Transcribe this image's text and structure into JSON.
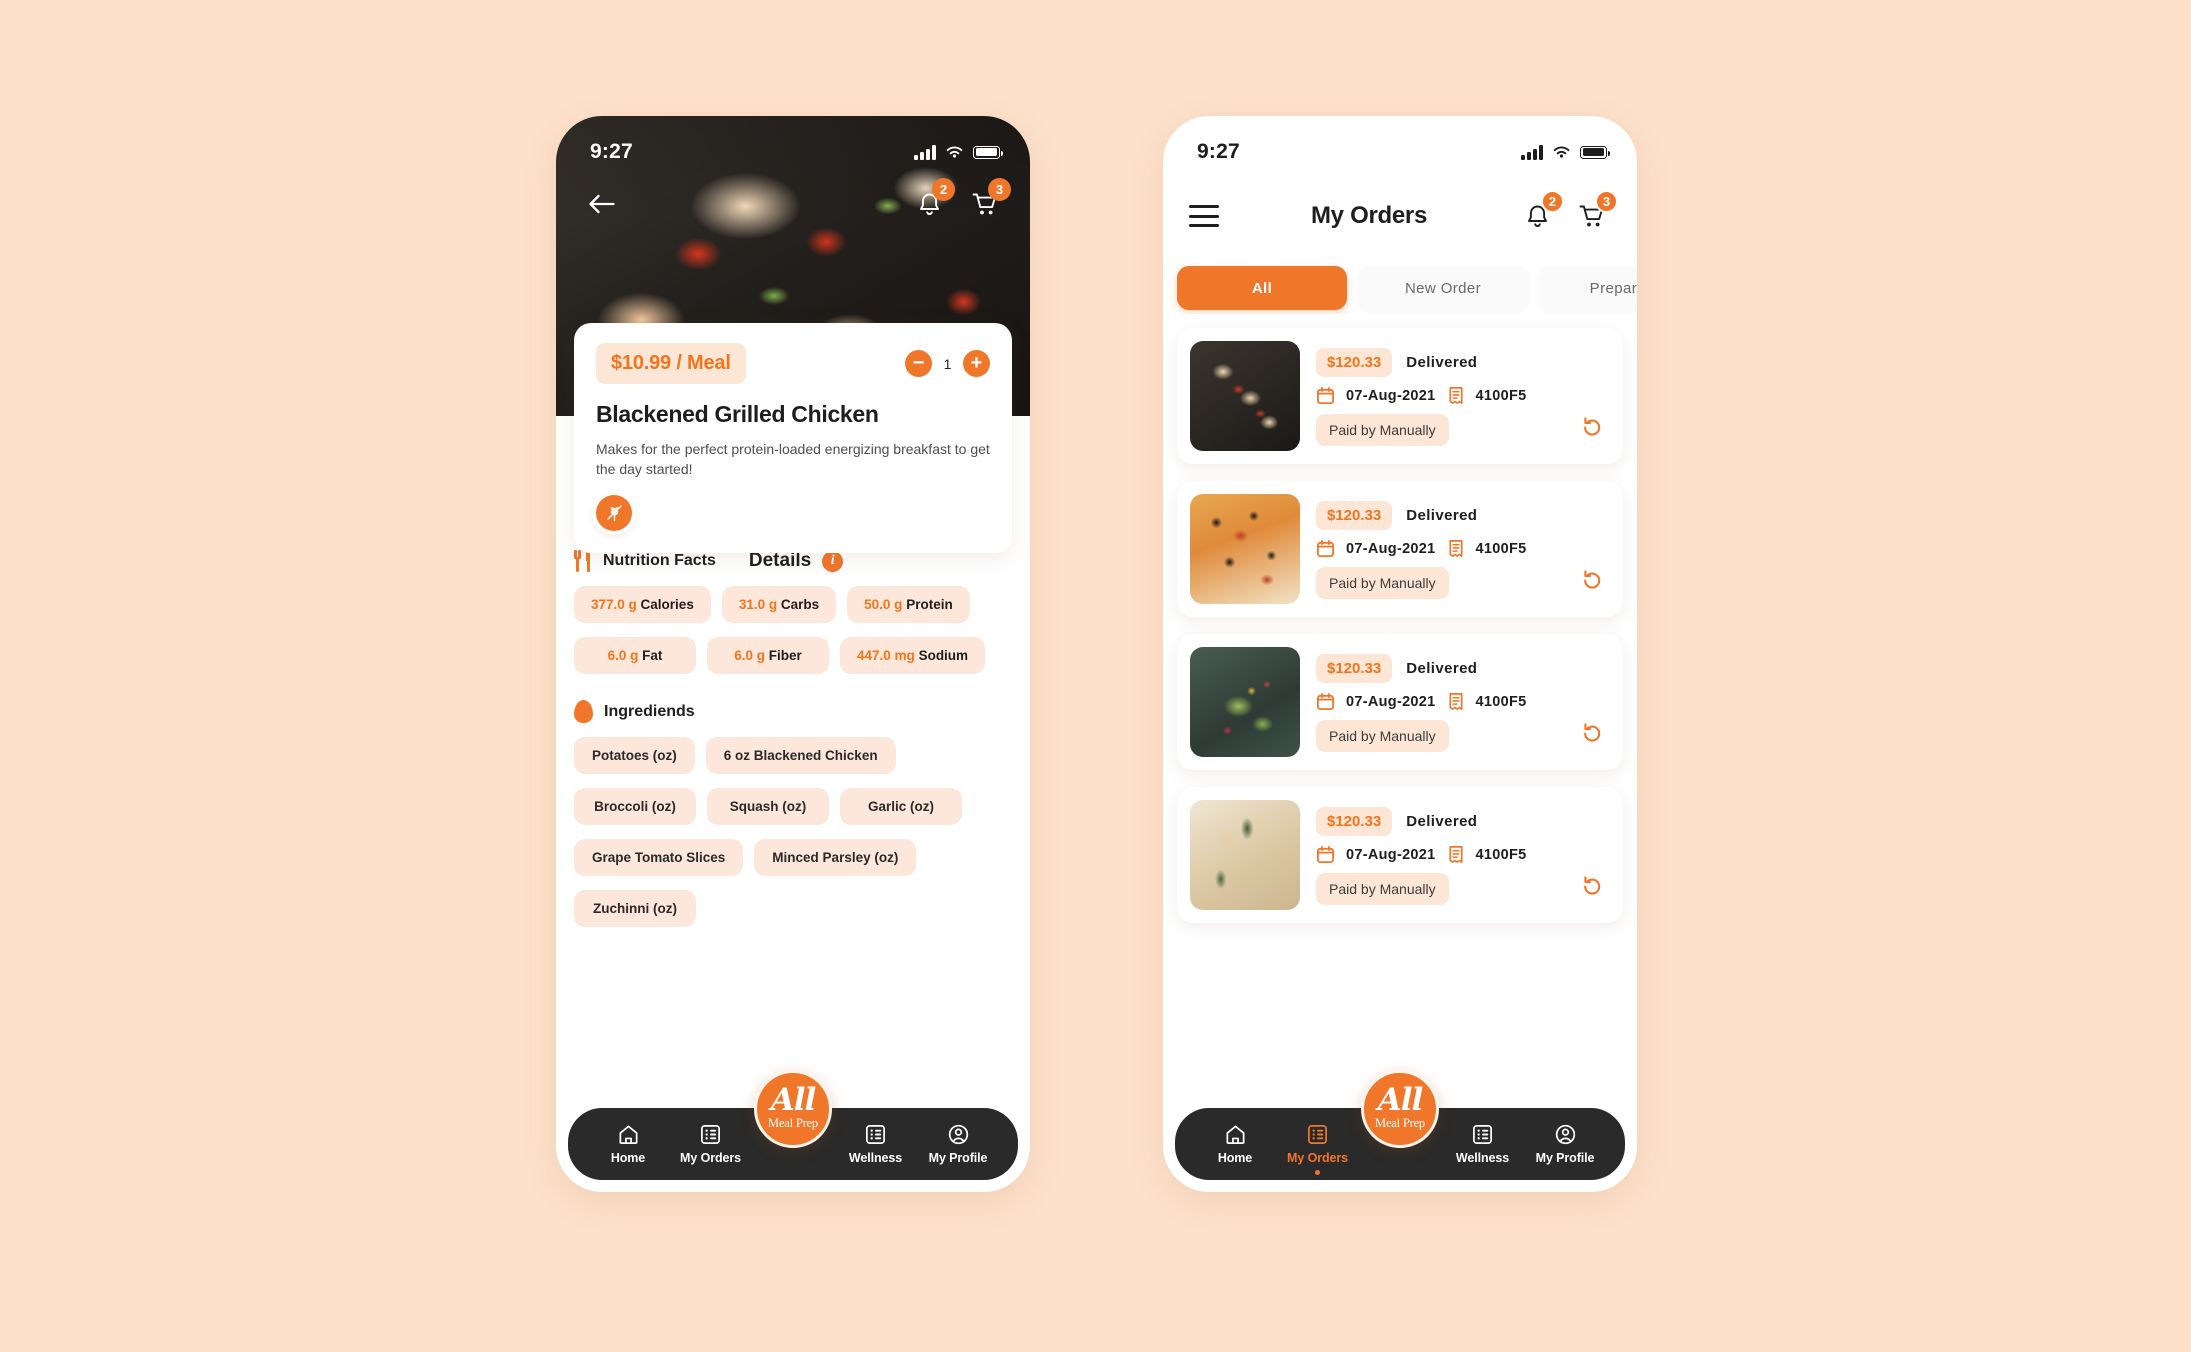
{
  "theme": {
    "page_background": "#FDE1CB",
    "accent_orange": "#F0762A",
    "accent_orange_text": "#F3741B",
    "chip_background": "#FDE7DA",
    "nav_background": "#2A2A2A",
    "card_white": "#FFFFFF"
  },
  "brand": {
    "logo_main": "All",
    "logo_sub": "Meal Prep"
  },
  "nav": {
    "items": [
      {
        "label": "Home",
        "icon": "home-icon",
        "active": false
      },
      {
        "label": "My Orders",
        "icon": "list-icon",
        "active": false
      },
      {
        "label": "Wellness",
        "icon": "list-icon",
        "active": false
      },
      {
        "label": "My Profile",
        "icon": "user-circle-icon",
        "active": false
      }
    ],
    "items_orders_screen": [
      {
        "label": "Home",
        "icon": "home-icon",
        "active": false
      },
      {
        "label": "My Orders",
        "icon": "list-icon",
        "active": true
      },
      {
        "label": "Wellness",
        "icon": "list-icon",
        "active": false
      },
      {
        "label": "My Profile",
        "icon": "user-circle-icon",
        "active": false
      }
    ]
  },
  "detail_screen": {
    "status_bar": {
      "time": "9:27",
      "signal": "signal-icon",
      "wifi": "wifi-icon",
      "battery": "battery-icon"
    },
    "back": "back-arrow-icon",
    "notifications": {
      "icon": "bell-icon",
      "badge": "2"
    },
    "cart": {
      "icon": "cart-icon",
      "badge": "3"
    },
    "meal": {
      "price": "$10.99 / Meal",
      "quantity": "1",
      "decrement": "−",
      "increment": "+",
      "title": "Blackened Grilled Chicken",
      "description": "Makes for the perfect protein-loaded energizing breakfast to get the day started!",
      "diet_badge_icon": "gluten-free-icon"
    },
    "nutrition": {
      "section_label": "Nutrition Facts",
      "section_icon": "fork-knife-icon",
      "details_label": "Details",
      "details_info_icon": "info-icon",
      "facts": [
        {
          "value": "377.0 g",
          "label": "Calories"
        },
        {
          "value": "31.0 g",
          "label": "Carbs"
        },
        {
          "value": "50.0 g",
          "label": "Protein"
        },
        {
          "value": "6.0 g",
          "label": "Fat"
        },
        {
          "value": "6.0 g",
          "label": "Fiber"
        },
        {
          "value": "447.0 mg",
          "label": "Sodium"
        }
      ]
    },
    "ingredients": {
      "section_label": "Ingrediends",
      "section_icon": "egg-icon",
      "rows": [
        [
          "Potatoes (oz)",
          "6 oz Blackened Chicken"
        ],
        [
          "Broccoli (oz)",
          "Squash (oz)",
          "Garlic (oz)"
        ],
        [
          "Grape Tomato Slices",
          "Minced Parsley (oz)"
        ],
        [
          "Zuchinni (oz)"
        ]
      ]
    }
  },
  "orders_screen": {
    "status_bar": {
      "time": "9:27",
      "signal": "signal-icon",
      "wifi": "wifi-icon",
      "battery": "battery-icon"
    },
    "menu_icon": "hamburger-menu-icon",
    "title": "My Orders",
    "notifications": {
      "icon": "bell-icon",
      "badge": "2"
    },
    "cart": {
      "icon": "cart-icon",
      "badge": "3"
    },
    "tabs": [
      {
        "label": "All",
        "active": true
      },
      {
        "label": "New Order",
        "active": false
      },
      {
        "label": "Preparing",
        "active": false
      }
    ],
    "orders": [
      {
        "thumb": "t-skewer",
        "amount": "$120.33",
        "status": "Delivered",
        "date": "07-Aug-2021",
        "order_id": "4100F5",
        "payment": "Paid by Manually",
        "reorder_icon": "reorder-icon"
      },
      {
        "thumb": "t-pizza",
        "amount": "$120.33",
        "status": "Delivered",
        "date": "07-Aug-2021",
        "order_id": "4100F5",
        "payment": "Paid by Manually",
        "reorder_icon": "reorder-icon"
      },
      {
        "thumb": "t-salad",
        "amount": "$120.33",
        "status": "Delivered",
        "date": "07-Aug-2021",
        "order_id": "4100F5",
        "payment": "Paid by Manually",
        "reorder_icon": "reorder-icon"
      },
      {
        "thumb": "t-pasta",
        "amount": "$120.33",
        "status": "Delivered",
        "date": "07-Aug-2021",
        "order_id": "4100F5",
        "payment": "Paid by Manually",
        "reorder_icon": "reorder-icon"
      }
    ]
  }
}
